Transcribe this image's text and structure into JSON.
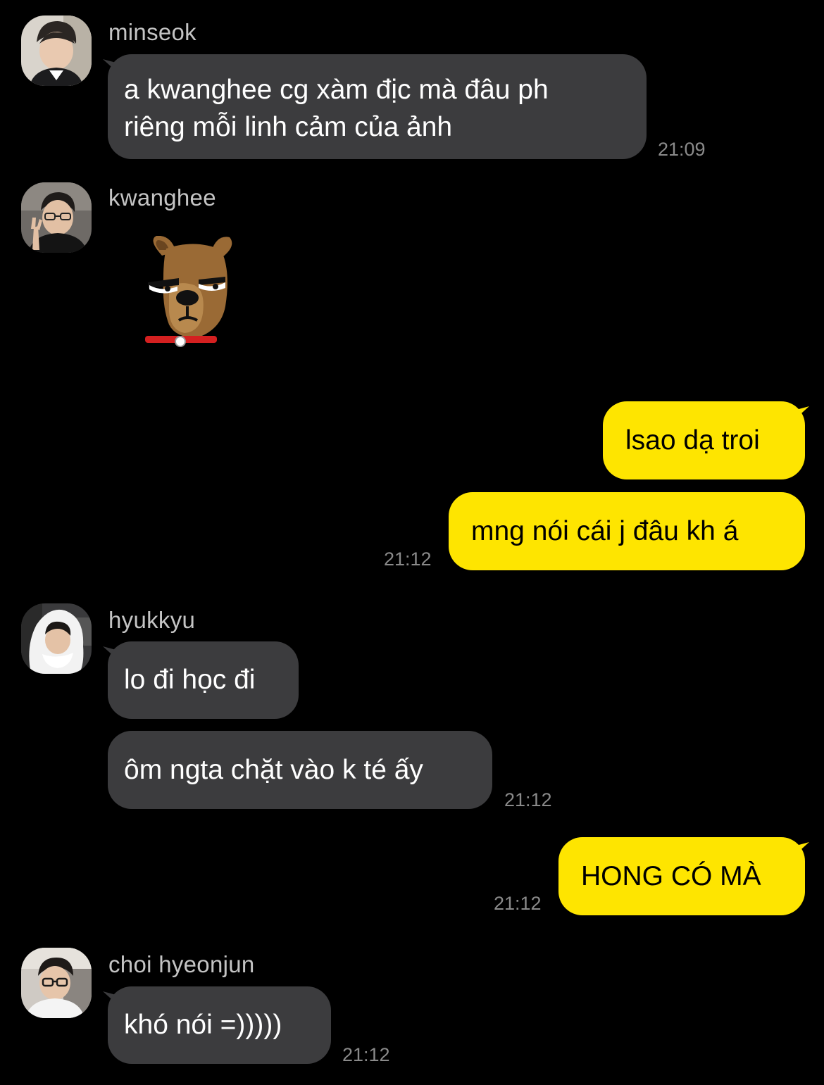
{
  "messages": {
    "m1": {
      "sender": "minseok",
      "lines": [
        "a kwanghee cg xàm địc mà đâu ph",
        "riêng mỗi linh cảm của ảnh"
      ],
      "time": "21:09"
    },
    "m2": {
      "sender": "kwanghee",
      "sticker": "grumpy-dog-sticker"
    },
    "m3": {
      "text": "lsao dạ troi"
    },
    "m4": {
      "text": "mng nói cái j đâu kh á",
      "time": "21:12"
    },
    "m5": {
      "sender": "hyukkyu",
      "text": "lo đi học đi"
    },
    "m6": {
      "text": "ôm ngta chặt vào k té ấy",
      "time": "21:12"
    },
    "m7": {
      "text": "HONG CÓ MÀ",
      "time": "21:12"
    },
    "m8": {
      "sender": "choi hyeonjun",
      "text": "khó nói =)))))",
      "time": "21:12"
    }
  },
  "colors": {
    "background": "#000000",
    "incoming_bubble": "#3c3c3e",
    "outgoing_bubble": "#fee500",
    "sender_name": "#c4c4c4",
    "timestamp": "#8a8a8a"
  }
}
